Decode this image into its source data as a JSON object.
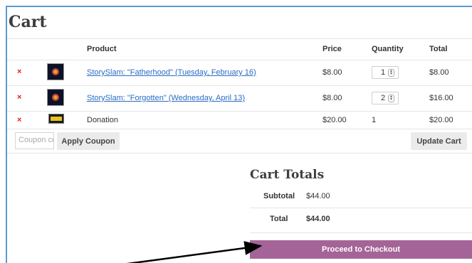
{
  "page": {
    "title": "Cart"
  },
  "table": {
    "headers": {
      "product": "Product",
      "price": "Price",
      "quantity": "Quantity",
      "total": "Total"
    },
    "rows": [
      {
        "remove": "×",
        "product": "StorySlam: \"Fatherhood\" (Tuesday, February 16)",
        "price": "$8.00",
        "quantity": "1",
        "total": "$8.00"
      },
      {
        "remove": "×",
        "product": "StorySlam: \"Forgotten\" (Wednesday, April 13)",
        "price": "$8.00",
        "quantity": "2",
        "total": "$16.00"
      },
      {
        "remove": "×",
        "product": "Donation",
        "price": "$20.00",
        "quantity": "1",
        "total": "$20.00"
      }
    ]
  },
  "coupon": {
    "placeholder": "Coupon code",
    "apply_label": "Apply Coupon"
  },
  "update_label": "Update Cart",
  "totals": {
    "title": "Cart Totals",
    "subtotal_label": "Subtotal",
    "subtotal_value": "$44.00",
    "total_label": "Total",
    "total_value": "$44.00"
  },
  "checkout_label": "Proceed to Checkout",
  "colors": {
    "accent": "#a46497",
    "link": "#2b6cc4",
    "remove": "#e02020",
    "frame": "#5b9bd5"
  }
}
